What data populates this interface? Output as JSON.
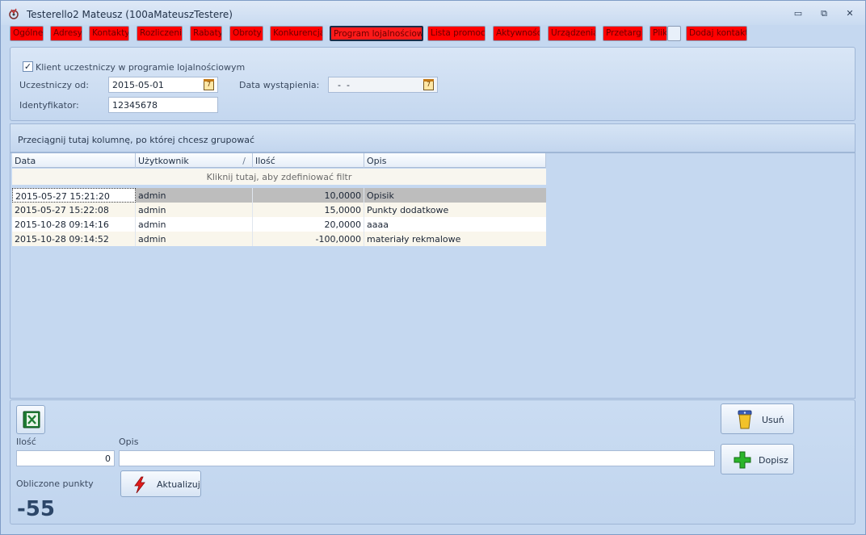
{
  "window": {
    "title": "Testerello2 Mateusz (100aMateuszTestere)",
    "minimize_glyph": "▭",
    "restore_glyph": "⧉",
    "close_glyph": "✕"
  },
  "tabs": [
    {
      "label": "Ogólne"
    },
    {
      "label": "Adresy"
    },
    {
      "label": "Kontakty"
    },
    {
      "label": "Rozliczenia"
    },
    {
      "label": "Rabaty"
    },
    {
      "label": "Obroty"
    },
    {
      "label": "Konkurencja"
    },
    {
      "label": "Program lojalnościowy",
      "active": true
    },
    {
      "label": "Lista promocji"
    },
    {
      "label": "Aktywności"
    },
    {
      "label": "Urządzenia"
    },
    {
      "label": "Przetargi"
    },
    {
      "label": "Pliki"
    },
    {
      "label": ""
    },
    {
      "label": "Dodaj kontakt"
    }
  ],
  "loyalty": {
    "checkbox_label": "Klient uczestniczy w programie lojalnościowym",
    "checkbox_glyph": "✓",
    "member_since_label": "Uczestniczy od:",
    "member_since_value": "2015-05-01",
    "exit_date_label": "Data wystąpienia:",
    "exit_date_value": "  -  -",
    "identifier_label": "Identyfikator:",
    "identifier_value": "12345678",
    "calendar_glyph": "7"
  },
  "grid": {
    "group_hint": "Przeciągnij tutaj kolumnę, po której chcesz grupować",
    "columns": [
      "Data",
      "Użytkownik",
      "Ilość",
      "Opis"
    ],
    "sort_glyph": "/",
    "filter_hint": "Kliknij tutaj, aby zdefiniować filtr",
    "rows": [
      {
        "date": "2015-05-27 15:21:20",
        "user": "admin",
        "qty": "10,0000",
        "desc": "Opisik"
      },
      {
        "date": "2015-05-27 15:22:08",
        "user": "admin",
        "qty": "15,0000",
        "desc": "Punkty dodatkowe"
      },
      {
        "date": "2015-10-28 09:14:16",
        "user": "admin",
        "qty": "20,0000",
        "desc": "aaaa"
      },
      {
        "date": "2015-10-28 09:14:52",
        "user": "admin",
        "qty": "-100,0000",
        "desc": "materiały rekmalowe"
      }
    ]
  },
  "bottom": {
    "qty_label": "Ilość",
    "qty_value": "0",
    "desc_label": "Opis",
    "desc_value": "",
    "points_label": "Obliczone punkty",
    "points_value": "-55",
    "update_button": "Aktualizuj",
    "delete_button": "Usuń",
    "add_button": "Dopisz",
    "excel_icon": "excel-export-icon"
  },
  "colors": {
    "tab_bg": "#ff0000",
    "window_bg": "#c5d8f0",
    "selected_row": "#bdbdbd"
  }
}
